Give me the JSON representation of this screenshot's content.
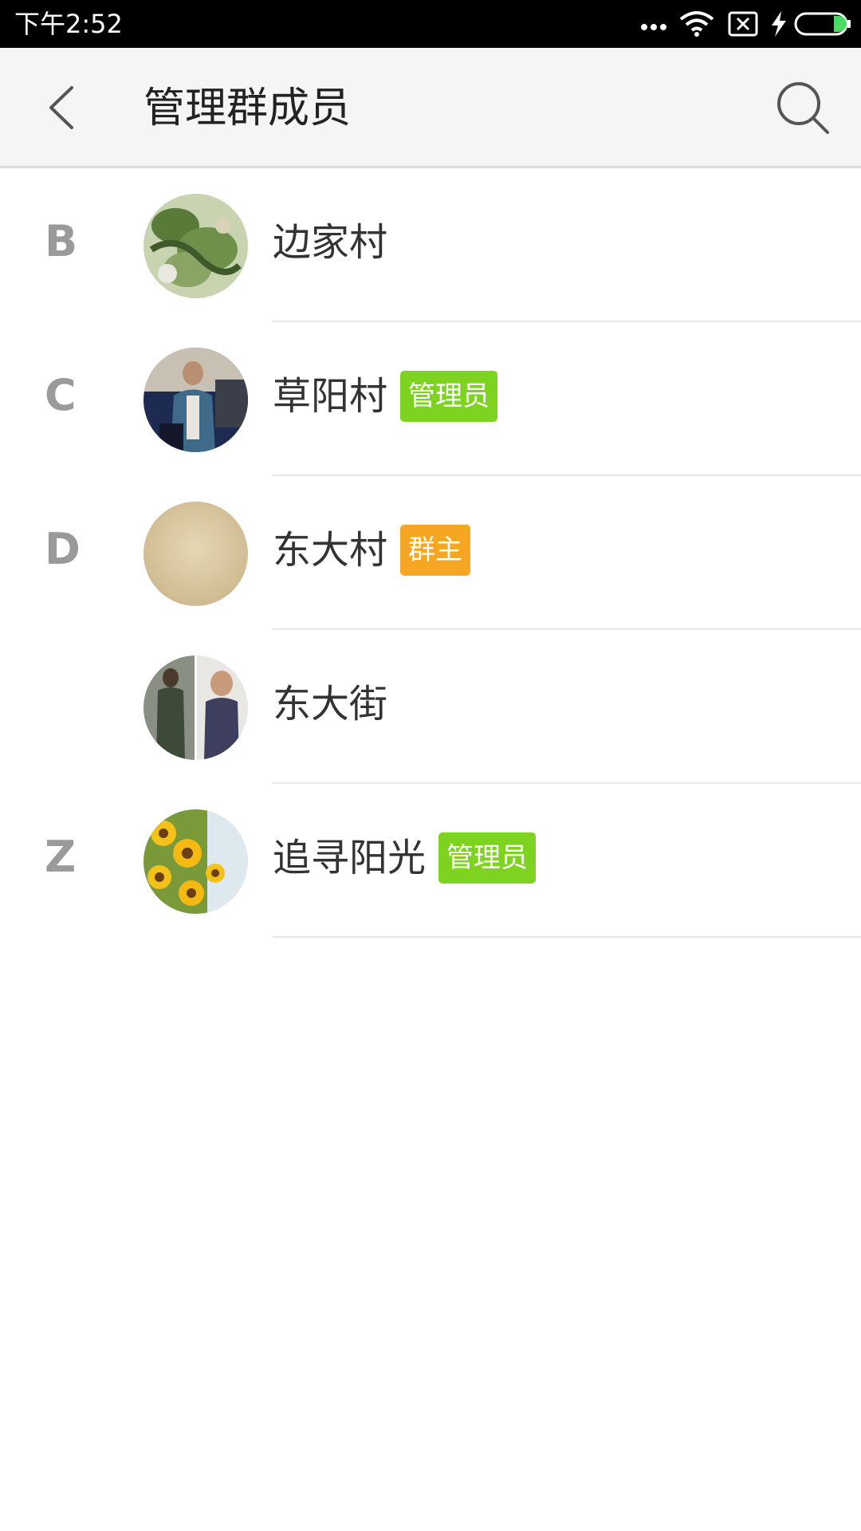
{
  "status_bar": {
    "time": "下午2:52",
    "icons": [
      "more-dots-icon",
      "wifi-icon",
      "no-sim-icon",
      "charging-icon",
      "battery-icon"
    ],
    "battery_color": "#4cd964"
  },
  "app_bar": {
    "title": "管理群成员",
    "back_icon": "chevron-left-icon",
    "search_icon": "search-icon"
  },
  "colors": {
    "admin_badge": "#7ed321",
    "owner_badge": "#f5a623",
    "section_letter": "#9a9a9a"
  },
  "members": [
    {
      "letter": "B",
      "name": "边家村",
      "badge": "",
      "avatar": "dragon-avatar"
    },
    {
      "letter": "C",
      "name": "草阳村",
      "badge": "管理员",
      "avatar": "man-photo-avatar"
    },
    {
      "letter": "D",
      "name": "东大村",
      "badge": "群主",
      "avatar": "beige-avatar"
    },
    {
      "letter": "",
      "name": "东大街",
      "badge": "",
      "avatar": "two-photos-avatar"
    },
    {
      "letter": "Z",
      "name": "追寻阳光",
      "badge": "管理员",
      "avatar": "sunflower-avatar"
    }
  ]
}
